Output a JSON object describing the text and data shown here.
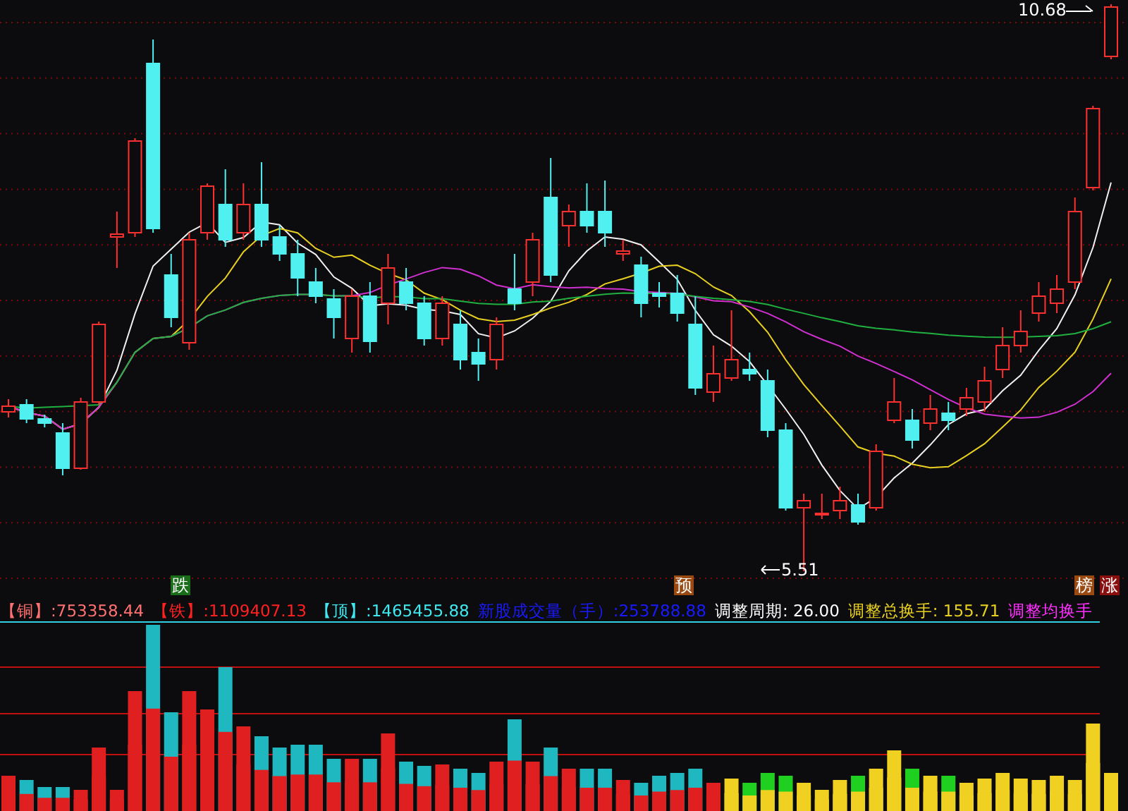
{
  "price_chart": {
    "high_label": "10.68",
    "low_label": "5.51"
  },
  "signals": [
    {
      "label": "跌",
      "color": "#1a6e1a"
    },
    {
      "label": "预",
      "color": "#9a4a10"
    },
    {
      "label": "榜",
      "color": "#9a4a10"
    },
    {
      "label": "涨",
      "color": "#8a1010"
    }
  ],
  "indicators": [
    {
      "text": "【铜】:753358.44",
      "color": "#ff7070"
    },
    {
      "text": "【铁】:1109407.13",
      "color": "#ff2020"
    },
    {
      "text": "【顶】:1465455.88",
      "color": "#40e8f0"
    },
    {
      "text": "新股成交量（手）:253788.88",
      "color": "#1a1aff"
    },
    {
      "text": "调整周期: 26.00",
      "color": "#ffffff"
    },
    {
      "text": "调整总换手: 155.71",
      "color": "#e8d020"
    },
    {
      "text": "调整均换手",
      "color": "#ff30ff"
    }
  ]
}
